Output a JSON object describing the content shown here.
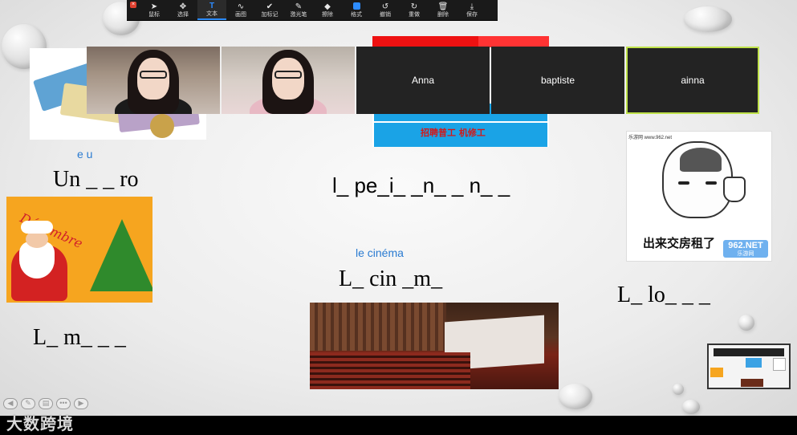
{
  "toolbar": {
    "items": [
      {
        "label": "鼠标",
        "icon": "pointer-icon"
      },
      {
        "label": "选择",
        "icon": "move-icon"
      },
      {
        "label": "文本",
        "icon": "text-icon",
        "active": true
      },
      {
        "label": "画图",
        "icon": "draw-icon"
      },
      {
        "label": "加标记",
        "icon": "check-icon"
      },
      {
        "label": "激光笔",
        "icon": "laser-icon"
      },
      {
        "label": "擦除",
        "icon": "eraser-icon"
      },
      {
        "label": "格式",
        "icon": "format-icon"
      },
      {
        "label": "撤销",
        "icon": "undo-icon"
      },
      {
        "label": "重做",
        "icon": "redo-icon"
      },
      {
        "label": "删除",
        "icon": "trash-icon"
      },
      {
        "label": "保存",
        "icon": "save-icon"
      }
    ],
    "accent": "#2d8cff"
  },
  "participants": [
    {
      "name": "",
      "video": true
    },
    {
      "name": "",
      "video": true
    },
    {
      "name": "Anna",
      "video": false
    },
    {
      "name": "baptiste",
      "video": false
    },
    {
      "name": "ainna",
      "video": false,
      "active_speaker": true
    }
  ],
  "slide": {
    "hints": {
      "euro": "e u",
      "cinema": "le cinéma"
    },
    "exercises": {
      "euro": "Un _ _ ro",
      "permis": "l_  pe_i_ _n_ _ n_ _",
      "cinema": "L_ cin _m_",
      "loto": "L_ lo_ _ _",
      "mois": "L_  m_ _ _"
    },
    "images": {
      "xmas_word": "Décembre",
      "meme_site": "乐游网 www.962.net",
      "meme_caption": "出来交房租了",
      "meme_badge": "962.NET",
      "meme_badge_sub": "乐游网",
      "poster_text": "招聘普工 机修工"
    }
  },
  "watermark": "大数跨境"
}
